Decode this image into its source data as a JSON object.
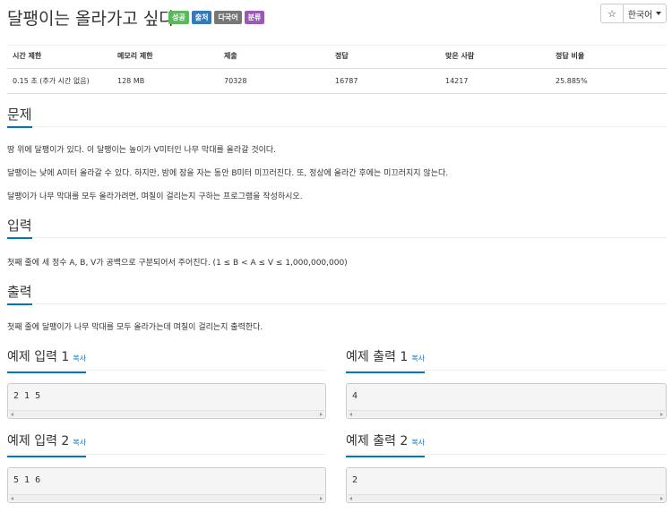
{
  "problem": {
    "title": "달팽이는 올라가고 싶다",
    "labels": [
      "성공",
      "출처",
      "다국어",
      "분류"
    ]
  },
  "header_buttons": {
    "star_icon": "star-icon",
    "star_glyph": "☆",
    "language": "한국어"
  },
  "stats": {
    "headers": [
      "시간 제한",
      "메모리 제한",
      "제출",
      "정답",
      "맞은 사람",
      "정답 비율"
    ],
    "values": [
      "0.15 초 (추가 시간 없음)",
      "128 MB",
      "70328",
      "16787",
      "14217",
      "25.885%"
    ]
  },
  "sections": {
    "description": {
      "title": "문제",
      "paragraphs": [
        "땅 위에 달팽이가 있다. 이 달팽이는 높이가 V미터인 나무 막대를 올라갈 것이다.",
        "달팽이는 낮에 A미터 올라갈 수 있다. 하지만, 밤에 잠을 자는 동안 B미터 미끄러진다. 또, 정상에 올라간 후에는 미끄러지지 않는다.",
        "달팽이가 나무 막대를 모두 올라가려면, 며칠이 걸리는지 구하는 프로그램을 작성하시오."
      ]
    },
    "input": {
      "title": "입력",
      "text": "첫째 줄에 세 정수 A, B, V가 공백으로 구분되어서 주어진다. (1 ≤ B < A ≤ V ≤ 1,000,000,000)"
    },
    "output": {
      "title": "출력",
      "text": "첫째 줄에 달팽이가 나무 막대를 모두 올라가는데 며칠이 걸리는지 출력한다."
    }
  },
  "samples": {
    "copy_label": "복사",
    "items": [
      {
        "title": "예제 입력 1",
        "content": "2 1 5"
      },
      {
        "title": "예제 출력 1",
        "content": "4"
      },
      {
        "title": "예제 입력 2",
        "content": "5 1 6"
      },
      {
        "title": "예제 출력 2",
        "content": "2"
      }
    ]
  }
}
